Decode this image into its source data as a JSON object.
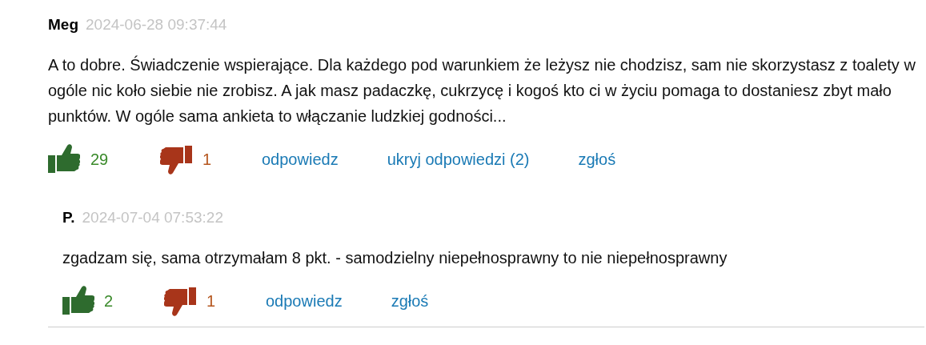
{
  "comment": {
    "author": "Meg",
    "date": "2024-06-28 09:37:44",
    "text": "A to dobre. Świadczenie wspierające. Dla każdego pod warunkiem że leżysz nie chodzisz, sam nie skorzystasz z toalety w ogóle nic koło siebie nie zrobisz. A jak masz padaczkę, cukrzycę i kogoś kto ci w życiu pomaga to dostaniesz zbyt mało punktów. W ogóle sama ankieta to włączanie ludzkiej godności...",
    "likes": "29",
    "dislikes": "1",
    "actions": [
      "odpowiedz",
      "ukryj odpowiedzi (2)",
      "zgłoś"
    ],
    "replies": [
      {
        "author": "P.",
        "date": "2024-07-04 07:53:22",
        "text": "zgadzam się, sama otrzymałam 8 pkt. - samodzielny niepełnosprawny to nie niepełnosprawny",
        "likes": "2",
        "dislikes": "1",
        "actions": [
          "odpowiedz",
          "zgłoś"
        ]
      }
    ]
  }
}
